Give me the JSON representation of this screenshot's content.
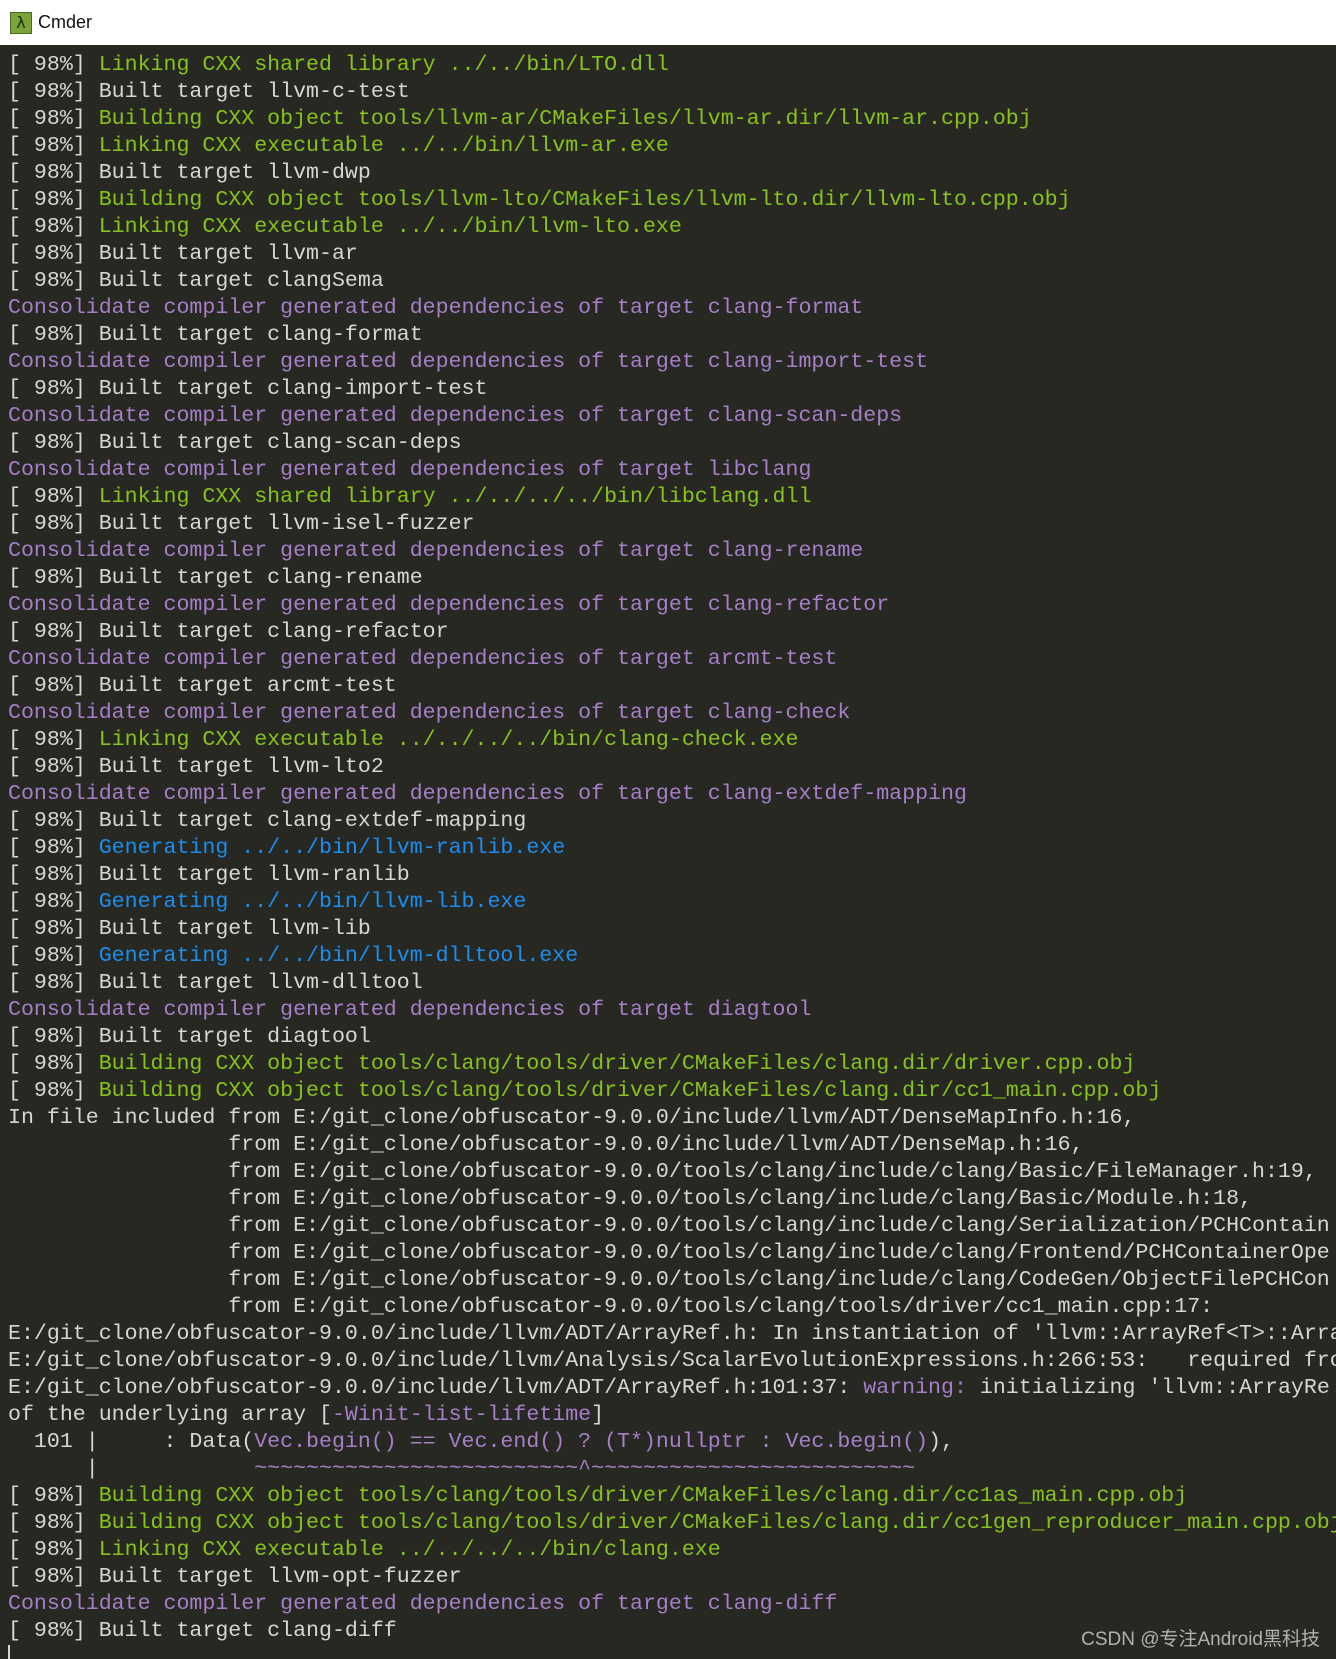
{
  "window": {
    "title": "Cmder",
    "icon": "lambda-icon"
  },
  "colors": {
    "w": "#d6d6d6",
    "g": "#87c31a",
    "p": "#a67ec9",
    "b": "#1b8ef0",
    "background": "#272822"
  },
  "terminal": {
    "lines": [
      [
        [
          "w",
          "[ 98%] "
        ],
        [
          "g",
          "Linking CXX shared library ../../bin/LTO.dll"
        ]
      ],
      [
        [
          "w",
          "[ 98%] Built target llvm-c-test"
        ]
      ],
      [
        [
          "w",
          "[ 98%] "
        ],
        [
          "g",
          "Building CXX object tools/llvm-ar/CMakeFiles/llvm-ar.dir/llvm-ar.cpp.obj"
        ]
      ],
      [
        [
          "w",
          "[ 98%] "
        ],
        [
          "g",
          "Linking CXX executable ../../bin/llvm-ar.exe"
        ]
      ],
      [
        [
          "w",
          "[ 98%] Built target llvm-dwp"
        ]
      ],
      [
        [
          "w",
          "[ 98%] "
        ],
        [
          "g",
          "Building CXX object tools/llvm-lto/CMakeFiles/llvm-lto.dir/llvm-lto.cpp.obj"
        ]
      ],
      [
        [
          "w",
          "[ 98%] "
        ],
        [
          "g",
          "Linking CXX executable ../../bin/llvm-lto.exe"
        ]
      ],
      [
        [
          "w",
          "[ 98%] Built target llvm-ar"
        ]
      ],
      [
        [
          "w",
          "[ 98%] Built target clangSema"
        ]
      ],
      [
        [
          "p",
          "Consolidate compiler generated dependencies of target clang-format"
        ]
      ],
      [
        [
          "w",
          "[ 98%] Built target clang-format"
        ]
      ],
      [
        [
          "p",
          "Consolidate compiler generated dependencies of target clang-import-test"
        ]
      ],
      [
        [
          "w",
          "[ 98%] Built target clang-import-test"
        ]
      ],
      [
        [
          "p",
          "Consolidate compiler generated dependencies of target clang-scan-deps"
        ]
      ],
      [
        [
          "w",
          "[ 98%] Built target clang-scan-deps"
        ]
      ],
      [
        [
          "p",
          "Consolidate compiler generated dependencies of target libclang"
        ]
      ],
      [
        [
          "w",
          "[ 98%] "
        ],
        [
          "g",
          "Linking CXX shared library ../../../../bin/libclang.dll"
        ]
      ],
      [
        [
          "w",
          "[ 98%] Built target llvm-isel-fuzzer"
        ]
      ],
      [
        [
          "p",
          "Consolidate compiler generated dependencies of target clang-rename"
        ]
      ],
      [
        [
          "w",
          "[ 98%] Built target clang-rename"
        ]
      ],
      [
        [
          "p",
          "Consolidate compiler generated dependencies of target clang-refactor"
        ]
      ],
      [
        [
          "w",
          "[ 98%] Built target clang-refactor"
        ]
      ],
      [
        [
          "p",
          "Consolidate compiler generated dependencies of target arcmt-test"
        ]
      ],
      [
        [
          "w",
          "[ 98%] Built target arcmt-test"
        ]
      ],
      [
        [
          "p",
          "Consolidate compiler generated dependencies of target clang-check"
        ]
      ],
      [
        [
          "w",
          "[ 98%] "
        ],
        [
          "g",
          "Linking CXX executable ../../../../bin/clang-check.exe"
        ]
      ],
      [
        [
          "w",
          "[ 98%] Built target llvm-lto2"
        ]
      ],
      [
        [
          "p",
          "Consolidate compiler generated dependencies of target clang-extdef-mapping"
        ]
      ],
      [
        [
          "w",
          "[ 98%] Built target clang-extdef-mapping"
        ]
      ],
      [
        [
          "w",
          "[ 98%] "
        ],
        [
          "b",
          "Generating ../../bin/llvm-ranlib.exe"
        ]
      ],
      [
        [
          "w",
          "[ 98%] Built target llvm-ranlib"
        ]
      ],
      [
        [
          "w",
          "[ 98%] "
        ],
        [
          "b",
          "Generating ../../bin/llvm-lib.exe"
        ]
      ],
      [
        [
          "w",
          "[ 98%] Built target llvm-lib"
        ]
      ],
      [
        [
          "w",
          "[ 98%] "
        ],
        [
          "b",
          "Generating ../../bin/llvm-dlltool.exe"
        ]
      ],
      [
        [
          "w",
          "[ 98%] Built target llvm-dlltool"
        ]
      ],
      [
        [
          "p",
          "Consolidate compiler generated dependencies of target diagtool"
        ]
      ],
      [
        [
          "w",
          "[ 98%] Built target diagtool"
        ]
      ],
      [
        [
          "w",
          "[ 98%] "
        ],
        [
          "g",
          "Building CXX object tools/clang/tools/driver/CMakeFiles/clang.dir/driver.cpp.obj"
        ]
      ],
      [
        [
          "w",
          "[ 98%] "
        ],
        [
          "g",
          "Building CXX object tools/clang/tools/driver/CMakeFiles/clang.dir/cc1_main.cpp.obj"
        ]
      ],
      [
        [
          "w",
          "In file included from E:/git_clone/obfuscator-9.0.0/include/llvm/ADT/DenseMapInfo.h:16,"
        ]
      ],
      [
        [
          "w",
          "                 from E:/git_clone/obfuscator-9.0.0/include/llvm/ADT/DenseMap.h:16,"
        ]
      ],
      [
        [
          "w",
          "                 from E:/git_clone/obfuscator-9.0.0/tools/clang/include/clang/Basic/FileManager.h:19,"
        ]
      ],
      [
        [
          "w",
          "                 from E:/git_clone/obfuscator-9.0.0/tools/clang/include/clang/Basic/Module.h:18,"
        ]
      ],
      [
        [
          "w",
          "                 from E:/git_clone/obfuscator-9.0.0/tools/clang/include/clang/Serialization/PCHContain"
        ]
      ],
      [
        [
          "w",
          "                 from E:/git_clone/obfuscator-9.0.0/tools/clang/include/clang/Frontend/PCHContainerOpe"
        ]
      ],
      [
        [
          "w",
          "                 from E:/git_clone/obfuscator-9.0.0/tools/clang/include/clang/CodeGen/ObjectFilePCHCon"
        ]
      ],
      [
        [
          "w",
          "                 from E:/git_clone/obfuscator-9.0.0/tools/clang/tools/driver/cc1_main.cpp:17:"
        ]
      ],
      [
        [
          "w",
          "E:/git_clone/obfuscator-9.0.0/include/llvm/ADT/ArrayRef.h: In instantiation of 'llvm::ArrayRef<T>::Arra"
        ]
      ],
      [
        [
          "w",
          "E:/git_clone/obfuscator-9.0.0/include/llvm/Analysis/ScalarEvolutionExpressions.h:266:53:   required fro"
        ]
      ],
      [
        [
          "w",
          "E:/git_clone/obfuscator-9.0.0/include/llvm/ADT/ArrayRef.h:101:37: "
        ],
        [
          "p",
          "warning:"
        ],
        [
          "w",
          " initializing 'llvm::ArrayRe"
        ]
      ],
      [
        [
          "w",
          "of the underlying array ["
        ],
        [
          "p",
          "-Winit-list-lifetime"
        ],
        [
          "w",
          "]"
        ]
      ],
      [
        [
          "w",
          "  101 |     : Data("
        ],
        [
          "p",
          "Vec.begin() == Vec.end() ? (T*)nullptr : Vec.begin()"
        ],
        [
          "w",
          "),"
        ]
      ],
      [
        [
          "w",
          "      |            "
        ],
        [
          "p",
          "~~~~~~~~~~~~~~~~~~~~~~~~~^~~~~~~~~~~~~~~~~~~~~~~~~~"
        ]
      ],
      [
        [
          "w",
          "[ 98%] "
        ],
        [
          "g",
          "Building CXX object tools/clang/tools/driver/CMakeFiles/clang.dir/cc1as_main.cpp.obj"
        ]
      ],
      [
        [
          "w",
          "[ 98%] "
        ],
        [
          "g",
          "Building CXX object tools/clang/tools/driver/CMakeFiles/clang.dir/cc1gen_reproducer_main.cpp.obj"
        ]
      ],
      [
        [
          "w",
          "[ 98%] "
        ],
        [
          "g",
          "Linking CXX executable ../../../../bin/clang.exe"
        ]
      ],
      [
        [
          "w",
          "[ 98%] Built target llvm-opt-fuzzer"
        ]
      ],
      [
        [
          "p",
          "Consolidate compiler generated dependencies of target clang-diff"
        ]
      ],
      [
        [
          "w",
          "[ 98%] Built target clang-diff"
        ]
      ]
    ]
  },
  "watermark": "CSDN @专注Android黑科技"
}
